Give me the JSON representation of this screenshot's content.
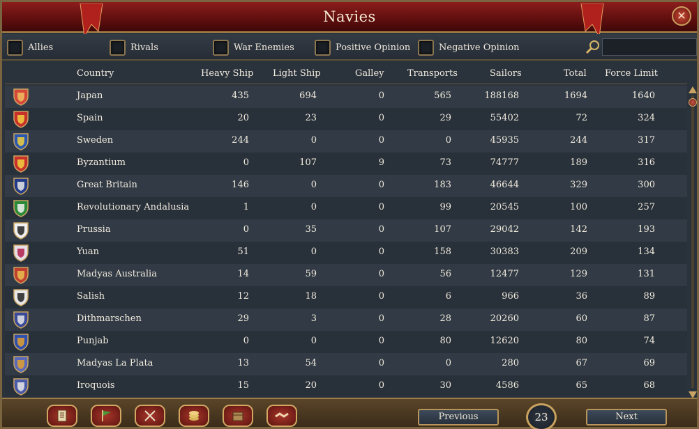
{
  "window": {
    "title": "Navies"
  },
  "filters": [
    {
      "label": "Allies",
      "checked": false
    },
    {
      "label": "Rivals",
      "checked": false
    },
    {
      "label": "War Enemies",
      "checked": false
    },
    {
      "label": "Positive Opinion",
      "checked": false
    },
    {
      "label": "Negative Opinion",
      "checked": false
    }
  ],
  "search": {
    "value": ""
  },
  "table": {
    "headers": {
      "country": "Country",
      "heavy": "Heavy Ship",
      "light": "Light Ship",
      "galley": "Galley",
      "transports": "Transports",
      "sailors": "Sailors",
      "total": "Total",
      "force": "Force Limit"
    },
    "rows": [
      {
        "country": "Japan",
        "heavy": "435",
        "light": "694",
        "galley": "0",
        "transports": "565",
        "sailors": "188168",
        "total": "1694",
        "force": "1640",
        "flag": "japan"
      },
      {
        "country": "Spain",
        "heavy": "20",
        "light": "23",
        "galley": "0",
        "transports": "29",
        "sailors": "55402",
        "total": "72",
        "force": "324",
        "flag": "spain"
      },
      {
        "country": "Sweden",
        "heavy": "244",
        "light": "0",
        "galley": "0",
        "transports": "0",
        "sailors": "45935",
        "total": "244",
        "force": "317",
        "flag": "sweden"
      },
      {
        "country": "Byzantium",
        "heavy": "0",
        "light": "107",
        "galley": "9",
        "transports": "73",
        "sailors": "74777",
        "total": "189",
        "force": "316",
        "flag": "byzantium"
      },
      {
        "country": "Great Britain",
        "heavy": "146",
        "light": "0",
        "galley": "0",
        "transports": "183",
        "sailors": "46644",
        "total": "329",
        "force": "300",
        "flag": "britain"
      },
      {
        "country": "Revolutionary Andalusia",
        "heavy": "1",
        "light": "0",
        "galley": "0",
        "transports": "99",
        "sailors": "20545",
        "total": "100",
        "force": "257",
        "flag": "andalusia"
      },
      {
        "country": "Prussia",
        "heavy": "0",
        "light": "35",
        "galley": "0",
        "transports": "107",
        "sailors": "29042",
        "total": "142",
        "force": "193",
        "flag": "prussia"
      },
      {
        "country": "Yuan",
        "heavy": "51",
        "light": "0",
        "galley": "0",
        "transports": "158",
        "sailors": "30383",
        "total": "209",
        "force": "134",
        "flag": "yuan"
      },
      {
        "country": "Madyas Australia",
        "heavy": "14",
        "light": "59",
        "galley": "0",
        "transports": "56",
        "sailors": "12477",
        "total": "129",
        "force": "131",
        "flag": "madyas-australia"
      },
      {
        "country": "Salish",
        "heavy": "12",
        "light": "18",
        "galley": "0",
        "transports": "6",
        "sailors": "966",
        "total": "36",
        "force": "89",
        "flag": "salish"
      },
      {
        "country": "Dithmarschen",
        "heavy": "29",
        "light": "3",
        "galley": "0",
        "transports": "28",
        "sailors": "20260",
        "total": "60",
        "force": "87",
        "flag": "dithmarschen"
      },
      {
        "country": "Punjab",
        "heavy": "0",
        "light": "0",
        "galley": "0",
        "transports": "80",
        "sailors": "12620",
        "total": "80",
        "force": "74",
        "flag": "punjab"
      },
      {
        "country": "Madyas La Plata",
        "heavy": "13",
        "light": "54",
        "galley": "0",
        "transports": "0",
        "sailors": "280",
        "total": "67",
        "force": "69",
        "flag": "madyas-la-plata"
      },
      {
        "country": "Iroquois",
        "heavy": "15",
        "light": "20",
        "galley": "0",
        "transports": "30",
        "sailors": "4586",
        "total": "65",
        "force": "68",
        "flag": "iroquois"
      }
    ]
  },
  "footer": {
    "tabs": [
      {
        "icon": "ledger-icon"
      },
      {
        "icon": "flag-icon"
      },
      {
        "icon": "crossed-swords-icon"
      },
      {
        "icon": "coins-icon"
      },
      {
        "icon": "trade-goods-icon"
      },
      {
        "icon": "handshake-icon"
      }
    ],
    "previous_label": "Previous",
    "next_label": "Next",
    "page_number": "23"
  },
  "colors": {
    "accent_gold": "#b08a4a",
    "title_red": "#7a1616",
    "row_alt": "#313a45",
    "row_base": "#28303a"
  }
}
